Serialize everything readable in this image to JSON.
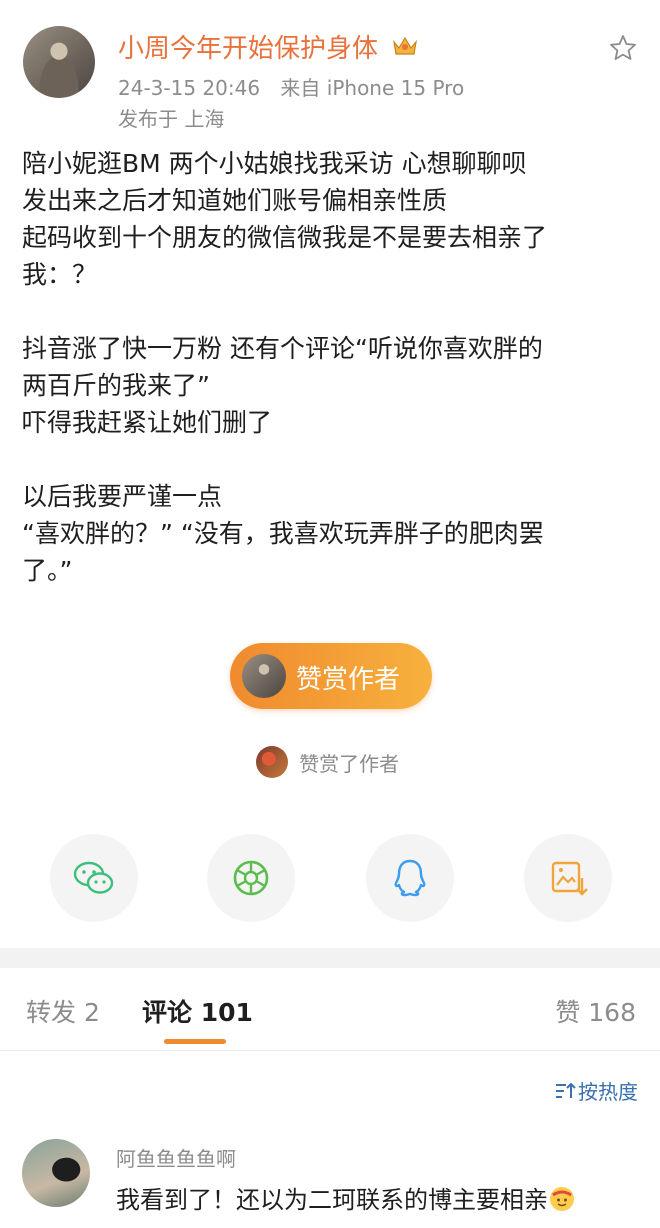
{
  "post": {
    "username": "小周今年开始保护身体",
    "timestamp": "24-3-15 20:46",
    "source": "来自 iPhone 15 Pro",
    "location": "发布于 上海",
    "paragraphs": [
      "陪小妮逛BM 两个小姑娘找我采访 心想聊聊呗\n发出来之后才知道她们账号偏相亲性质\n起码收到十个朋友的微信微我是不是要去相亲了\n我：？",
      "抖音涨了快一万粉 还有个评论“听说你喜欢胖的\n两百斤的我来了”\n吓得我赶紧让她们删了",
      "以后我要严谨一点\n“喜欢胖的？” “没有，我喜欢玩弄胖子的肥肉罢\n了。”"
    ]
  },
  "reward": {
    "button_label": "赞赏作者",
    "rewarded_label": "赞赏了作者"
  },
  "share": {
    "icons": [
      "wechat-icon",
      "moments-icon",
      "qq-icon",
      "save-image-icon"
    ]
  },
  "tabs": {
    "repost": "转发 2",
    "comments": "评论 101",
    "likes": "赞 168"
  },
  "sort": {
    "label": "按热度"
  },
  "comment": {
    "author": "阿鱼鱼鱼鱼啊",
    "text": "我看到了！还以为二珂联系的博主要相亲"
  },
  "colors": {
    "accent": "#e8723c",
    "orange_gradient": [
      "#f08a2f",
      "#f7b13d"
    ],
    "link": "#3a6fb0"
  }
}
